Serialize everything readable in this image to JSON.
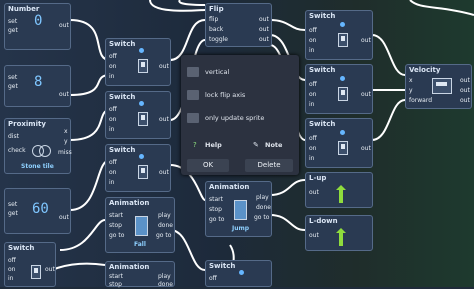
{
  "nodes": {
    "number1": {
      "title": "Number",
      "ports": [
        "set",
        "get"
      ],
      "out": "out",
      "value": "0"
    },
    "number2": {
      "ports": [
        "set",
        "get"
      ],
      "out": "out",
      "value": "8"
    },
    "proximity": {
      "title": "Proximity",
      "ports": [
        "dist",
        "check"
      ],
      "outs": [
        "x",
        "y",
        "miss"
      ],
      "sub": "Stone tile"
    },
    "number3": {
      "ports": [
        "set",
        "get"
      ],
      "out": "out",
      "value": "60"
    },
    "switch_left": {
      "title": "Switch",
      "ports": [
        "off",
        "on",
        "in"
      ],
      "out": "out"
    },
    "switch_a": {
      "title": "Switch",
      "ports": [
        "off",
        "on",
        "in"
      ],
      "out": "out"
    },
    "switch_b": {
      "title": "Switch",
      "ports": [
        "off",
        "on",
        "in"
      ],
      "out": "out"
    },
    "switch_c": {
      "title": "Switch",
      "ports": [
        "off",
        "on",
        "in"
      ],
      "out": "out"
    },
    "flip": {
      "title": "Flip",
      "ports": [
        "flip",
        "back",
        "toggle"
      ],
      "outs": [
        "out",
        "out",
        "out"
      ]
    },
    "switch_r1": {
      "title": "Switch",
      "ports": [
        "off",
        "on",
        "in"
      ],
      "out": "out"
    },
    "switch_r2": {
      "title": "Switch",
      "ports": [
        "off",
        "on",
        "in"
      ],
      "out": "out"
    },
    "switch_r3": {
      "title": "Switch",
      "ports": [
        "off",
        "on",
        "in"
      ],
      "out": "out"
    },
    "switch_r4": {
      "title": "Switch",
      "ports": [
        "off",
        "on",
        "in"
      ],
      "out": "out"
    },
    "switch_bottom": {
      "title": "Switch",
      "ports": [
        "off",
        "on",
        "in"
      ],
      "out": "out"
    },
    "velocity": {
      "title": "Velocity",
      "ports": [
        "x",
        "y",
        "forward"
      ],
      "outs": [
        "out",
        "out",
        "out"
      ]
    },
    "animation_fall": {
      "title": "Animation",
      "ports": [
        "start",
        "stop",
        "go to"
      ],
      "outs": [
        "play",
        "done",
        "go to"
      ],
      "sub": "Fall"
    },
    "animation_jump": {
      "title": "Animation",
      "ports": [
        "start",
        "stop",
        "go to"
      ],
      "outs": [
        "play",
        "done",
        "go to"
      ],
      "sub": "Jump"
    },
    "animation_bottom": {
      "title": "Animation",
      "ports": [
        "start",
        "stop"
      ],
      "outs": [
        "play",
        "done"
      ]
    },
    "lup": {
      "title": "L-up",
      "out": "out"
    },
    "ldown": {
      "title": "L-down",
      "out": "out"
    }
  },
  "panel": {
    "options": [
      "vertical",
      "lock flip axis",
      "only update sprite"
    ],
    "help": "Help",
    "note": "Note",
    "ok": "OK",
    "delete": "Delete"
  }
}
